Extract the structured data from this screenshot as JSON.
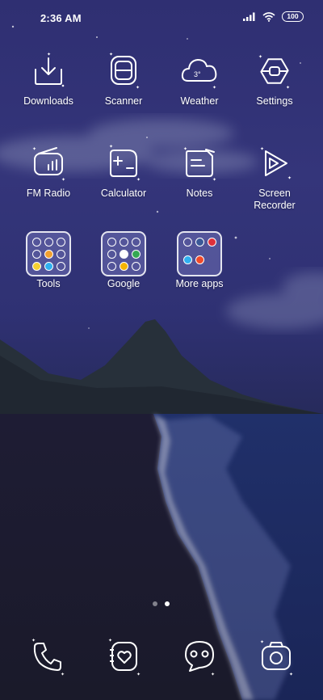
{
  "status_bar": {
    "time": "2:36 AM",
    "battery": "100",
    "icons": [
      "signal-icon",
      "wifi-icon",
      "battery-icon"
    ]
  },
  "apps": {
    "row1": [
      {
        "label": "Downloads",
        "icon": "download-icon"
      },
      {
        "label": "Scanner",
        "icon": "scanner-icon"
      },
      {
        "label": "Weather",
        "icon": "weather-cloud-icon",
        "badge": "3°"
      },
      {
        "label": "Settings",
        "icon": "settings-icon"
      }
    ],
    "row2": [
      {
        "label": "FM Radio",
        "icon": "radio-icon"
      },
      {
        "label": "Calculator",
        "icon": "calculator-icon"
      },
      {
        "label": "Notes",
        "icon": "notes-icon"
      },
      {
        "label": "Screen\nRecorder",
        "icon": "play-icon"
      }
    ],
    "row3": [
      {
        "label": "Tools",
        "icon": "folder-icon"
      },
      {
        "label": "Google",
        "icon": "folder-icon"
      },
      {
        "label": "More apps",
        "icon": "folder-icon"
      }
    ]
  },
  "page_indicator": {
    "pages": 2,
    "current": 2
  },
  "dock": [
    {
      "icon": "phone-icon"
    },
    {
      "icon": "contacts-heart-icon"
    },
    {
      "icon": "chat-bubble-icon"
    },
    {
      "icon": "camera-icon"
    }
  ],
  "colors": {
    "sky": "#2f3173",
    "sea": "#1f2a5e",
    "beach": "#1c1c2e",
    "mountain": "#232a33",
    "icon_stroke": "#ffffff"
  }
}
